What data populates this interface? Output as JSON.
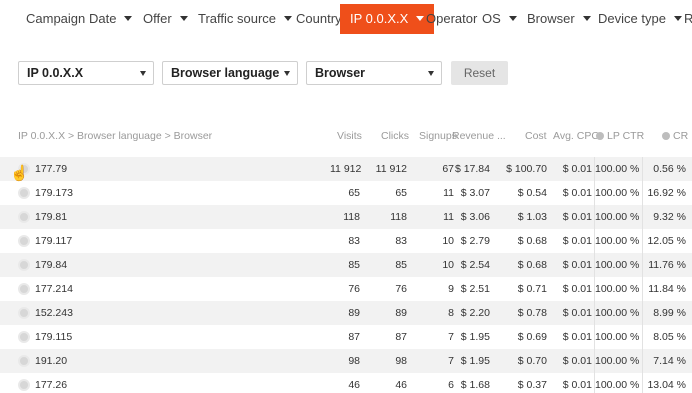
{
  "nav": {
    "items": [
      {
        "label": "Campaign",
        "caret": false
      },
      {
        "label": "Date",
        "caret": true
      },
      {
        "label": "Offer",
        "caret": true
      },
      {
        "label": "Traffic source",
        "caret": true
      },
      {
        "label": "Country",
        "caret": false
      },
      {
        "label": "IP 0.0.X.X",
        "caret": true,
        "active": true
      },
      {
        "label": "Operator",
        "caret": false
      },
      {
        "label": "OS",
        "caret": true
      },
      {
        "label": "Browser",
        "caret": true
      },
      {
        "label": "Device type",
        "caret": true
      },
      {
        "label": "R",
        "caret": false
      }
    ]
  },
  "filters": {
    "select1": "IP 0.0.X.X",
    "select2": "Browser language",
    "select3": "Browser",
    "reset_label": "Reset"
  },
  "table": {
    "breadcrumb": "IP 0.0.X.X > Browser language > Browser",
    "headers": [
      "Visits",
      "Clicks",
      "Signups",
      "Revenue",
      "Cost",
      "Avg. CPC",
      "LP CTR",
      "CR"
    ],
    "rows": [
      [
        "177.79",
        "11 912",
        "11 912",
        "67",
        "$ 17.84",
        "$ 100.70",
        "$ 0.01",
        "100.00 %",
        "0.56 %"
      ],
      [
        "179.173",
        "65",
        "65",
        "11",
        "$ 3.07",
        "$ 0.54",
        "$ 0.01",
        "100.00 %",
        "16.92 %"
      ],
      [
        "179.81",
        "118",
        "118",
        "11",
        "$ 3.06",
        "$ 1.03",
        "$ 0.01",
        "100.00 %",
        "9.32 %"
      ],
      [
        "179.117",
        "83",
        "83",
        "10",
        "$ 2.79",
        "$ 0.68",
        "$ 0.01",
        "100.00 %",
        "12.05 %"
      ],
      [
        "179.84",
        "85",
        "85",
        "10",
        "$ 2.54",
        "$ 0.68",
        "$ 0.01",
        "100.00 %",
        "11.76 %"
      ],
      [
        "177.214",
        "76",
        "76",
        "9",
        "$ 2.51",
        "$ 0.71",
        "$ 0.01",
        "100.00 %",
        "11.84 %"
      ],
      [
        "152.243",
        "89",
        "89",
        "8",
        "$ 2.20",
        "$ 0.78",
        "$ 0.01",
        "100.00 %",
        "8.99 %"
      ],
      [
        "179.115",
        "87",
        "87",
        "7",
        "$ 1.95",
        "$ 0.69",
        "$ 0.01",
        "100.00 %",
        "8.05 %"
      ],
      [
        "191.20",
        "98",
        "98",
        "7",
        "$ 1.95",
        "$ 0.70",
        "$ 0.01",
        "100.00 %",
        "7.14 %"
      ],
      [
        "177.26",
        "46",
        "46",
        "6",
        "$ 1.68",
        "$ 0.37",
        "$ 0.01",
        "100.00 %",
        "13.04 %"
      ]
    ]
  },
  "colors": {
    "accent": "#ef4f1a",
    "stripe": "#f2f2f2"
  }
}
